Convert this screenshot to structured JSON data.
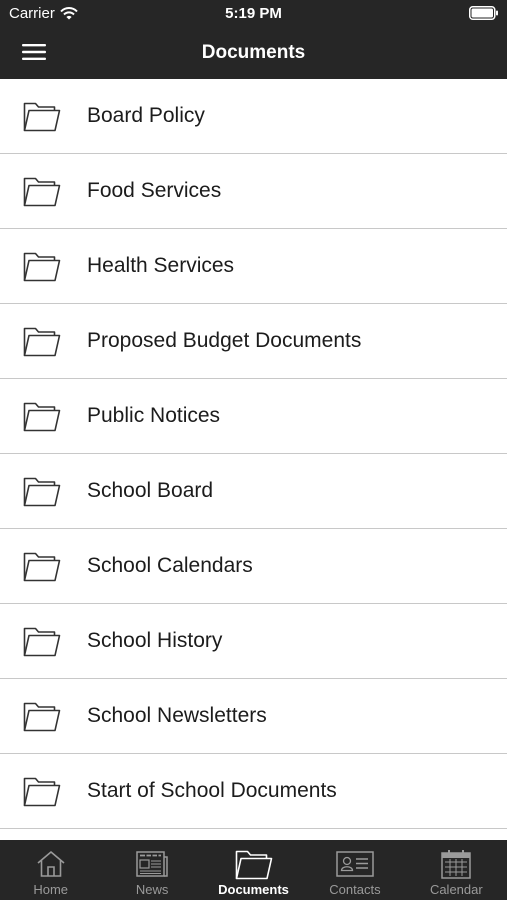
{
  "status_bar": {
    "carrier": "Carrier",
    "time": "5:19 PM"
  },
  "nav": {
    "title": "Documents",
    "menu_icon": "hamburger-menu-icon"
  },
  "documents": [
    {
      "label": "Board Policy",
      "icon": "folder-icon"
    },
    {
      "label": "Food Services",
      "icon": "folder-icon"
    },
    {
      "label": "Health Services",
      "icon": "folder-icon"
    },
    {
      "label": "Proposed Budget Documents",
      "icon": "folder-icon"
    },
    {
      "label": "Public Notices",
      "icon": "folder-icon"
    },
    {
      "label": "School Board",
      "icon": "folder-icon"
    },
    {
      "label": "School Calendars",
      "icon": "folder-icon"
    },
    {
      "label": "School History",
      "icon": "folder-icon"
    },
    {
      "label": "School Newsletters",
      "icon": "folder-icon"
    },
    {
      "label": "Start of School Documents",
      "icon": "folder-icon"
    }
  ],
  "tabs": [
    {
      "label": "Home",
      "icon": "home-icon",
      "active": false
    },
    {
      "label": "News",
      "icon": "newspaper-icon",
      "active": false
    },
    {
      "label": "Documents",
      "icon": "folder-icon",
      "active": true
    },
    {
      "label": "Contacts",
      "icon": "contact-card-icon",
      "active": false
    },
    {
      "label": "Calendar",
      "icon": "calendar-icon",
      "active": false
    }
  ],
  "colors": {
    "bar_background": "#262626",
    "tab_inactive": "#9a9a9a",
    "tab_active": "#ffffff",
    "divider": "#c8c8c8"
  }
}
